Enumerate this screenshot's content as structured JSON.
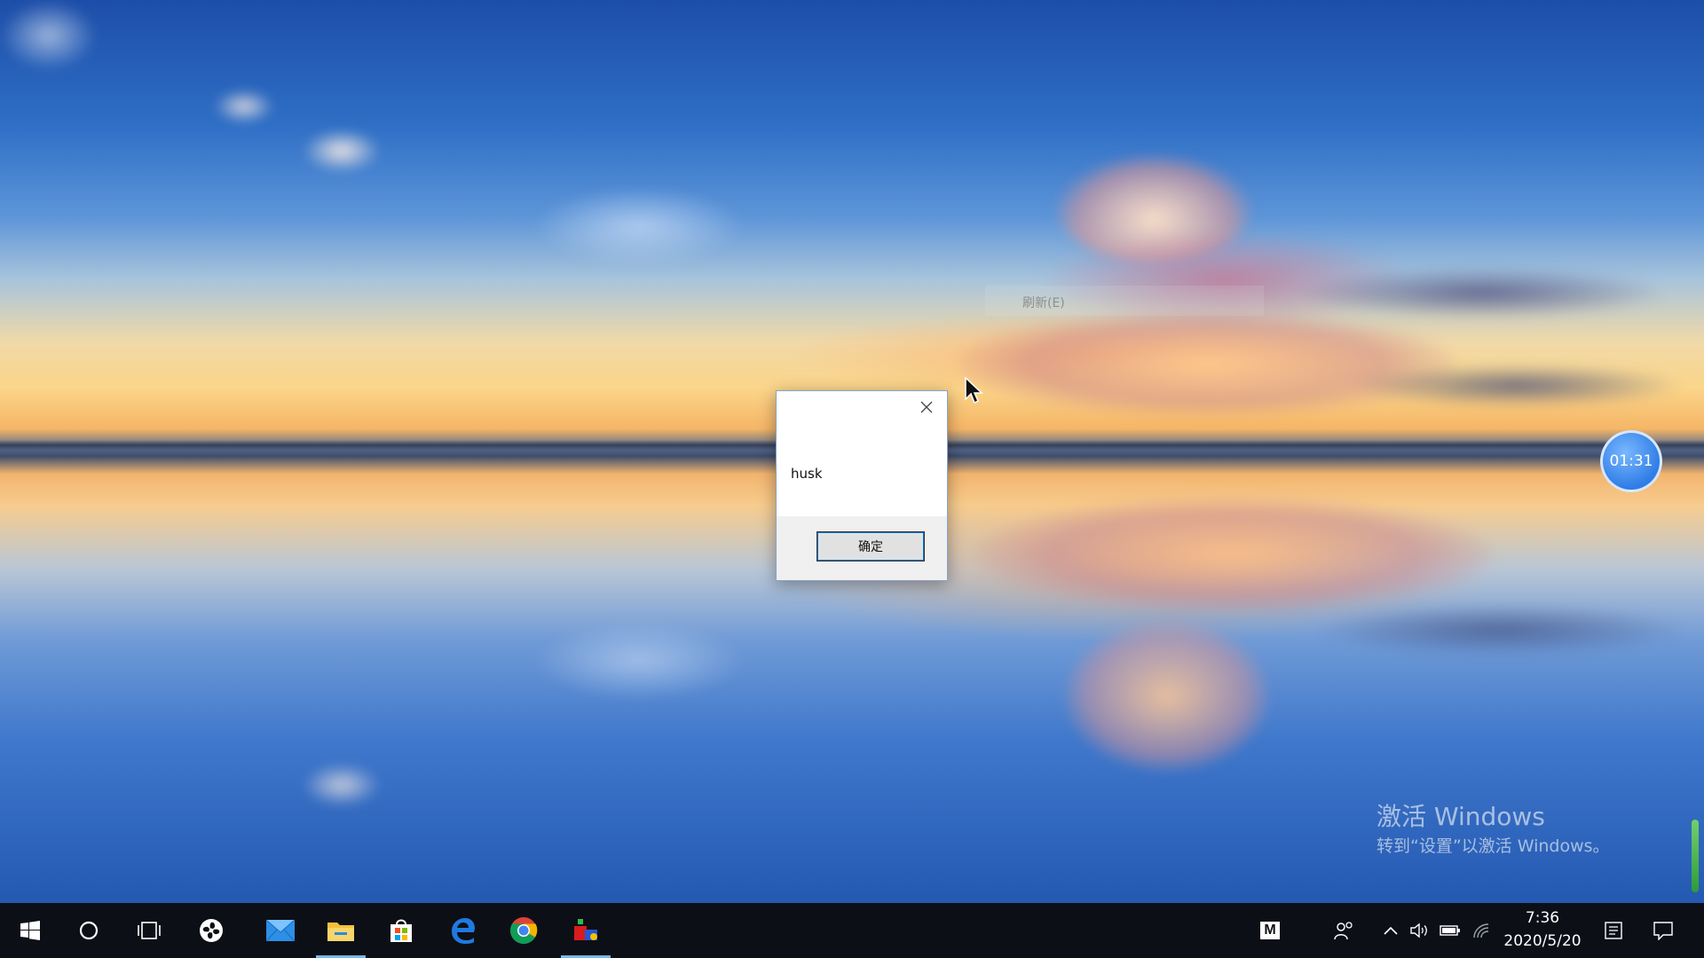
{
  "desktop": {
    "context_menu_item": "刷新(E)",
    "timer": "01:31",
    "watermark": {
      "title": "激活 Windows",
      "subtitle": "转到“设置”以激活 Windows。"
    }
  },
  "dialog": {
    "message": "husk",
    "ok_label": "确定"
  },
  "taskbar": {
    "apps": [
      {
        "name": "start",
        "icon": "windows-logo-icon"
      },
      {
        "name": "search",
        "icon": "cortana-circle-icon"
      },
      {
        "name": "task-view",
        "icon": "task-view-icon"
      },
      {
        "name": "fan-app",
        "icon": "fan-icon"
      },
      {
        "name": "mail",
        "icon": "mail-icon"
      },
      {
        "name": "file-explorer",
        "icon": "folder-icon",
        "active": true
      },
      {
        "name": "store",
        "icon": "store-bag-icon"
      },
      {
        "name": "edge",
        "icon": "edge-e-icon"
      },
      {
        "name": "chrome",
        "icon": "chrome-icon"
      },
      {
        "name": "media-app",
        "icon": "media-app-icon",
        "active": true
      }
    ],
    "tray": {
      "ime_label": "M",
      "time": "7:36",
      "date": "2020/5/20"
    }
  },
  "colors": {
    "taskbar_bg": "#0d0f17",
    "accent": "#76b9ed",
    "timer": "#2f7de6"
  }
}
